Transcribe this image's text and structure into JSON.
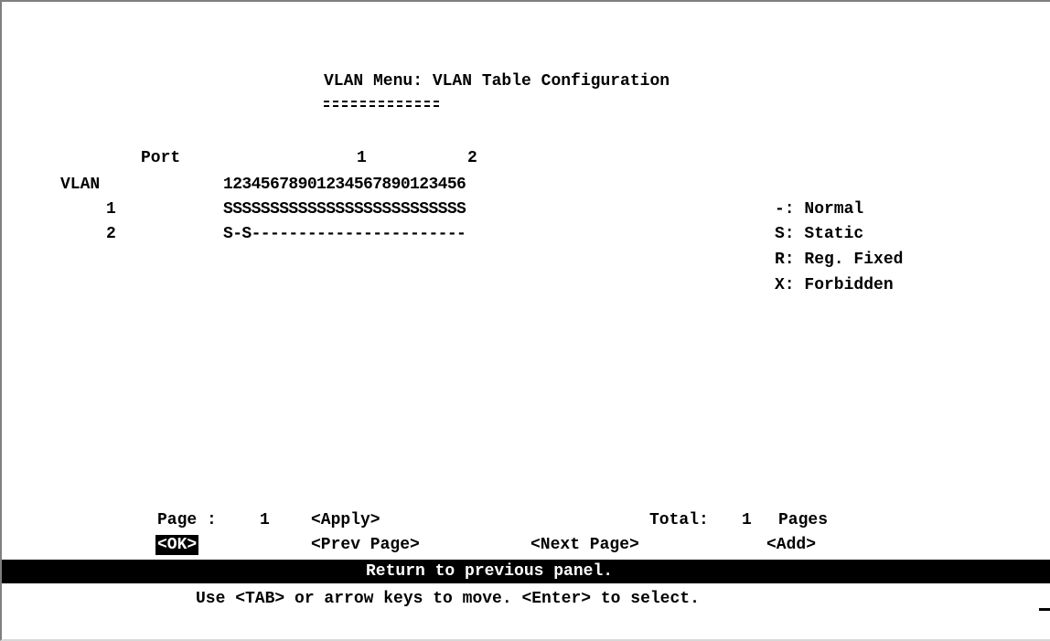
{
  "screen": {
    "title": "VLAN Menu: VLAN Table Configuration",
    "title_underline": "========="
  },
  "table": {
    "port_label": "Port",
    "tens_digit_1": "1",
    "tens_digit_2": "2",
    "port_digits": "12345678901234567890123456",
    "vlan_label": "VLAN",
    "rows": [
      {
        "vlan_id": "1",
        "membership": "SSSSSSSSSSSSSSSSSSSSSSSSSS"
      },
      {
        "vlan_id": "2",
        "membership": "S-S-----------------------"
      }
    ]
  },
  "legend": [
    {
      "code": "-",
      "text": "-: Normal"
    },
    {
      "code": "S",
      "text": "S: Static"
    },
    {
      "code": "R",
      "text": "R: Reg. Fixed"
    },
    {
      "code": "X",
      "text": "X: Forbidden"
    }
  ],
  "pager": {
    "page_label": "Page :",
    "page_number": "1",
    "total_label": "Total:",
    "total_pages": "1",
    "pages_label": "Pages"
  },
  "actions": {
    "apply": "<Apply>",
    "ok": "<OK>",
    "prev_page": "<Prev Page>",
    "next_page": "<Next Page>",
    "add": "<Add>"
  },
  "status_bar": {
    "message": "Return to previous panel."
  },
  "help_line": {
    "text": "Use <TAB> or arrow keys to move. <Enter> to select."
  },
  "colors": {
    "background": "#ffffff",
    "text": "#000000",
    "highlight_bg": "#000000",
    "highlight_text": "#ffffff"
  }
}
